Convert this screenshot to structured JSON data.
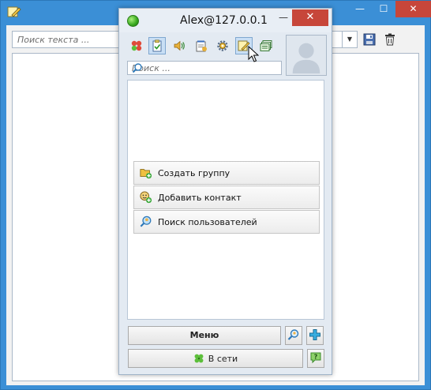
{
  "background_window": {
    "search_placeholder": "Поиск текста ...",
    "minimize_glyph": "—",
    "maximize_glyph": "☐",
    "close_glyph": "✕"
  },
  "contact_window": {
    "title": "Alex@127.0.0.1",
    "status_color": "#37a81e",
    "minimize_glyph": "—",
    "close_glyph": "✕",
    "toolbar_icons": [
      "status-flower-icon",
      "clipboard-icon",
      "speaker-icon",
      "notes-icon",
      "settings-gear-icon",
      "notes-pencil-icon",
      "message-history-icon"
    ],
    "active_toolbar_icon": "notes-pencil-icon",
    "search_placeholder": "Поиск ...",
    "actions": [
      {
        "label": "Создать группу",
        "icon": "folder-add-icon"
      },
      {
        "label": "Добавить контакт",
        "icon": "contact-add-icon"
      },
      {
        "label": "Поиск пользователей",
        "icon": "user-search-icon"
      }
    ],
    "menu_label": "Меню",
    "status_label": "В сети",
    "help_glyph": "?",
    "add_glyph": "+"
  },
  "colors": {
    "accent": "#3b8fd6",
    "close_red": "#c7463a",
    "online_green": "#37a81e"
  }
}
